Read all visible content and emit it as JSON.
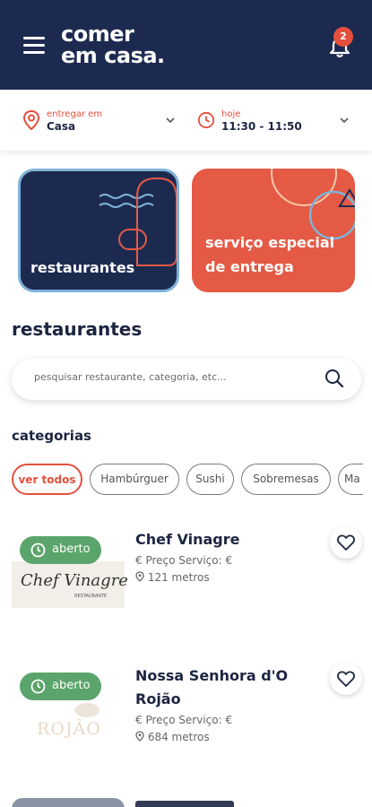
{
  "header": {
    "logo_line1": "comer",
    "logo_line2": "em casa.",
    "notification_count": "2",
    "colors": {
      "navy": "#1d2a50",
      "accent": "#e4503e"
    }
  },
  "delivery": {
    "address_label": "entregar em",
    "address_value": "Casa",
    "time_label": "hoje",
    "time_value": "11:30 - 11:50"
  },
  "promo_cards": [
    {
      "label": "restaurantes"
    },
    {
      "label_line1": "serviço especial",
      "label_line2": "de entrega"
    }
  ],
  "main": {
    "section_title": "restaurantes",
    "search_placeholder": "pesquisar restaurante, categoria, etc...",
    "categories_title": "categorias",
    "categories": [
      "ver todos",
      "Hambúrguer",
      "Sushi",
      "Sobremesas",
      "Ma"
    ]
  },
  "restaurants": [
    {
      "status": "aberto",
      "name_line1": "Chef Vinagre",
      "name_line2": "",
      "service": "Preço Serviço: €",
      "distance": "121 metros",
      "logo_text": "Chef Vinagre",
      "logo_subtext": "RESTAURANTE"
    },
    {
      "status": "aberto",
      "name_line1": "Nossa Senhora d'O",
      "name_line2": "Rojão",
      "service": "Preço Serviço: €",
      "distance": "684 metros",
      "logo_text": "ROJÃO",
      "logo_subtext": ""
    }
  ],
  "icons": {
    "menu": "hamburger-icon",
    "bell": "bell-icon",
    "location": "location-pin-icon",
    "clock": "clock-icon",
    "search": "search-icon",
    "heart": "heart-icon",
    "euro": "euro-icon"
  }
}
